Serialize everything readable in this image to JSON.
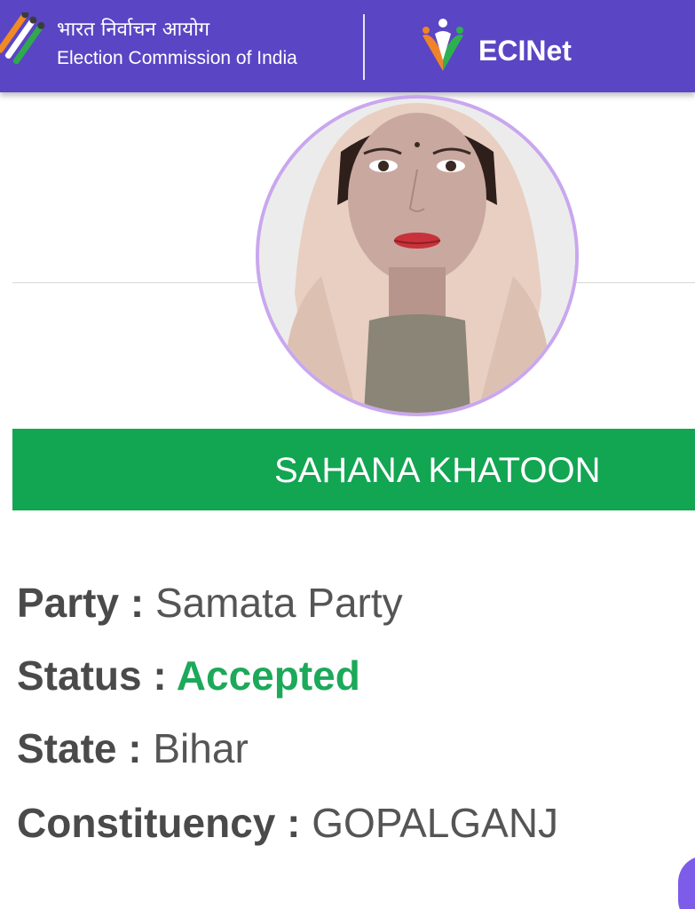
{
  "header": {
    "hindi_title": "भारत निर्वाचन आयोग",
    "english_title": "Election Commission of India",
    "app_name": "ECINet",
    "background_color": "#5a45c4"
  },
  "candidate": {
    "photo_icon": "candidate-photo",
    "name": "SAHANA KHATOON",
    "banner_color": "#12a552"
  },
  "details": {
    "party_label": "Party",
    "party_value": "Samata Party",
    "status_label": "Status",
    "status_value": "Accepted",
    "status_color": "#1ca95a",
    "state_label": "State",
    "state_value": "Bihar",
    "constituency_label": "Constituency",
    "constituency_value": "GOPALGANJ",
    "separator": " : "
  }
}
